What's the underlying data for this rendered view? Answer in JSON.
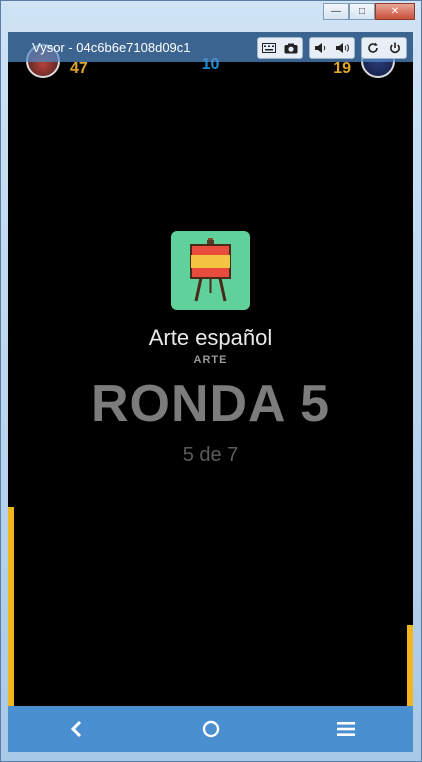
{
  "window": {
    "controls": [
      "minimize",
      "restore",
      "close"
    ]
  },
  "vysor": {
    "title": "Vysor - 04c6b6e7108d09c1",
    "tools": [
      "keyboard-icon",
      "camera-icon",
      "volume-down-icon",
      "volume-up-icon",
      "rotate-icon",
      "power-icon"
    ]
  },
  "game": {
    "player_left_score": "47",
    "player_right_score": "19",
    "center_counter": "10",
    "category": "Arte español",
    "subcategory": "ARTE",
    "round_title": "RONDA 5",
    "round_progress": "5 de 7",
    "timer_left_fraction": 0.3,
    "timer_right_fraction": 0.12
  },
  "colors": {
    "score": "#e0a52a",
    "counter": "#1a8fd6",
    "tile": "#5fd19a",
    "timer": "#f2b51d",
    "nav": "#4a8fcf"
  },
  "navbar": {
    "buttons": [
      "back-icon",
      "home-icon",
      "menu-icon"
    ]
  }
}
